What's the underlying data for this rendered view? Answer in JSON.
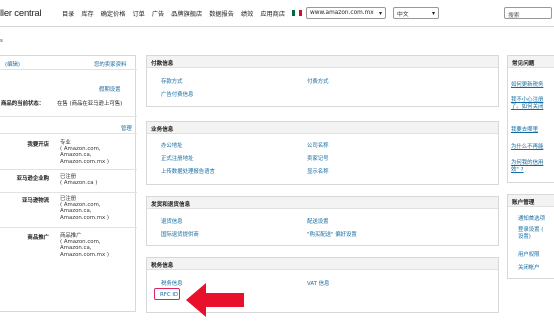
{
  "topbar": {
    "brand": "ller central",
    "nav": [
      "目录",
      "库存",
      "确定价格",
      "订单",
      "广告",
      "品牌旗舰店",
      "数据报告",
      "绩效",
      "应用商店"
    ],
    "marketplace": "www.amazon.com.mx",
    "language": "中文",
    "search_placeholder": "搜索"
  },
  "breadcrumb": "s",
  "left": {
    "edit_link": "(编辑)",
    "seller_profile_link": "您的卖家资料",
    "vacation_settings_link": "假期设置",
    "listing_status_label": "商品的当前状态：",
    "listing_status_value": "在售 (商品在亚马逊上可售)",
    "manage_link": "管理",
    "rows": [
      {
        "label": "我要开店",
        "value": "专业\n( Amazon.com,\nAmazon.ca,\nAmazon.com.mx )"
      },
      {
        "label": "亚马逊企业购",
        "value": "已注册\n( Amazon.ca )"
      },
      {
        "label": "亚马逊物流",
        "value": "已注册\n( Amazon.com,\nAmazon.ca,\nAmazon.com.mx )"
      },
      {
        "label": "商品推广",
        "value": "商品推广\n( Amazon.com,\nAmazon.ca,\nAmazon.com.mx )"
      }
    ]
  },
  "payment": {
    "title": "付款信息",
    "links": [
      "存款方式",
      "付费方式",
      "广告付费信息"
    ]
  },
  "business": {
    "title": "业务信息",
    "links": [
      "办公地址",
      "公司名称",
      "正式注册地址",
      "卖家记号",
      "上传数据处理报告语言",
      "显示名称"
    ]
  },
  "shipping": {
    "title": "发货和退货信息",
    "links": [
      "退货信息",
      "配送设置",
      "国际退货提供商",
      "\"购买配送\" 偏好设置"
    ]
  },
  "tax": {
    "title": "税务信息",
    "links": [
      "税务信息",
      "VAT 信息",
      "RFC ID"
    ]
  },
  "faq": {
    "title": "常见问题",
    "links": [
      "如何更新税务",
      "我不小心注册\n了。如何关闭",
      "我要去哪里",
      "为什么不再能",
      "为何我的信用\n效\" ?"
    ]
  },
  "account": {
    "title": "账户管理",
    "links": [
      "通知首选项",
      "登录设置 (\n设置)",
      "用户权限",
      "关闭帐户"
    ]
  },
  "colors": {
    "link": "#136ba0",
    "highlight": "#e0245e",
    "arrow": "#e8102a"
  }
}
